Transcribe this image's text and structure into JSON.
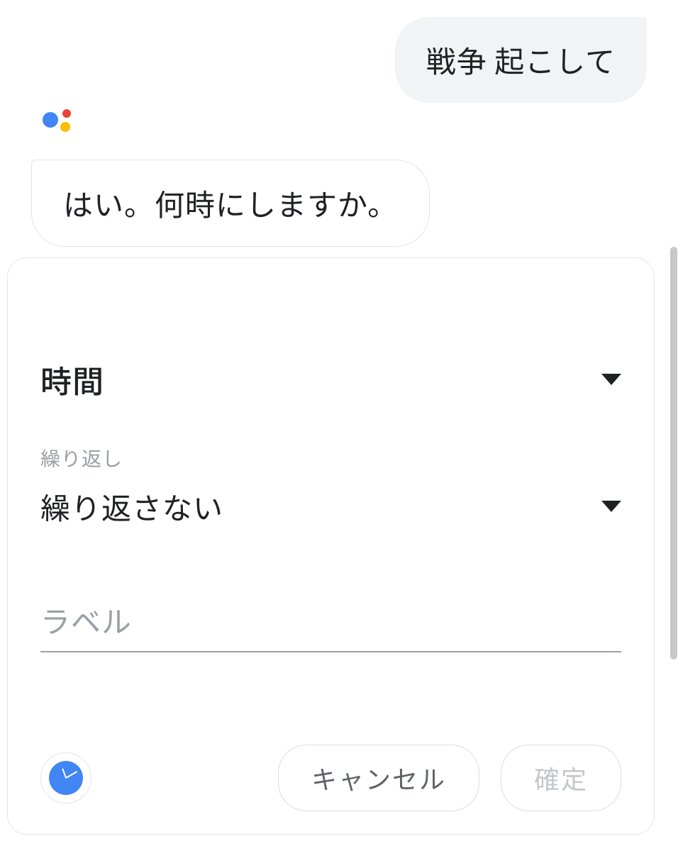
{
  "conversation": {
    "user_message": "戦争 起こして",
    "assistant_message": "はい。何時にしますか。"
  },
  "card": {
    "time_label": "時間",
    "repeat_small_label": "繰り返し",
    "repeat_value": "繰り返さない",
    "label_placeholder": "ラベル",
    "label_value": "",
    "cancel_label": "キャンセル",
    "confirm_label": "確定"
  }
}
